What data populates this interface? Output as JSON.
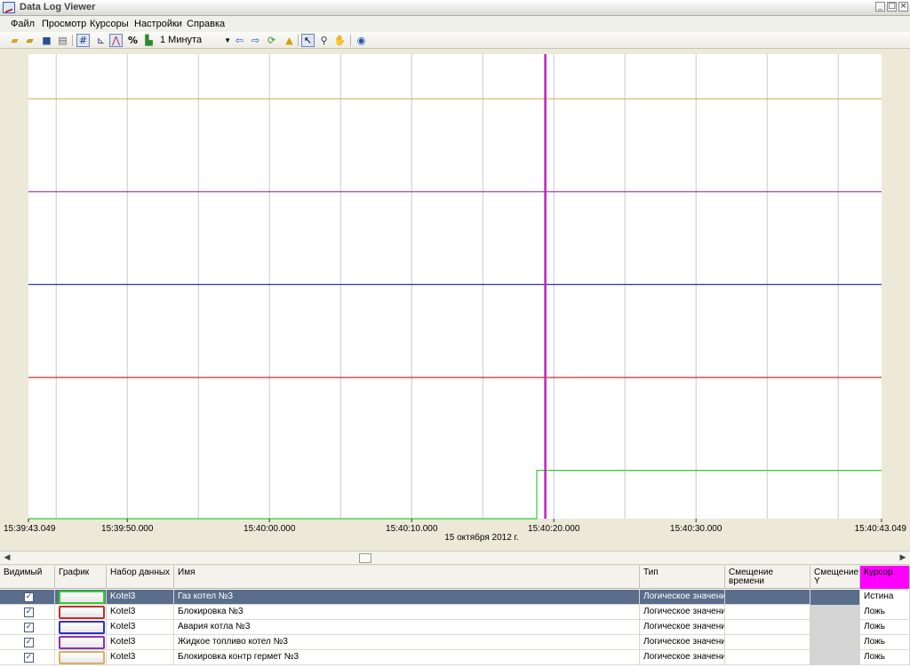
{
  "window": {
    "title": "Data Log Viewer"
  },
  "menu": [
    "Файл",
    "Просмотр",
    "Курсоры",
    "Настройки",
    "Справка"
  ],
  "toolbar": {
    "interval": "1 Минута",
    "percent_icon": "%"
  },
  "chart_data": {
    "type": "line",
    "x_ticks": [
      "15:39:43.049",
      "15:39:50.000",
      "15:40:00.000",
      "15:40:10.000",
      "15:40:20.000",
      "15:40:30.000",
      "15:40:43.049"
    ],
    "date_label": "15 октября 2012 г.",
    "x_range": [
      "15:39:43.049",
      "15:40:43.049"
    ],
    "cursor_time": "15:40:19.4",
    "grid": true,
    "series": [
      {
        "color": "#33cc33",
        "points": [
          [
            "15:39:43.049",
            0
          ],
          [
            "15:40:18.8",
            0
          ],
          [
            "15:40:18.8",
            1
          ],
          [
            "15:40:43.049",
            1
          ]
        ]
      },
      {
        "color": "#c03030",
        "points": [
          [
            "15:39:43.049",
            1
          ],
          [
            "15:40:43.049",
            1
          ]
        ]
      },
      {
        "color": "#3030c0",
        "points": [
          [
            "15:39:43.049",
            1
          ],
          [
            "15:40:43.049",
            1
          ]
        ]
      },
      {
        "color": "#9030b0",
        "points": [
          [
            "15:39:43.049",
            1
          ],
          [
            "15:40:43.049",
            1
          ]
        ]
      },
      {
        "color": "#d8b060",
        "points": [
          [
            "15:39:43.049",
            1
          ],
          [
            "15:40:43.049",
            1
          ]
        ]
      }
    ]
  },
  "table": {
    "headers": {
      "visible": "Видимый",
      "graph": "График",
      "dataset": "Набор данных",
      "name": "Имя",
      "type": "Тип",
      "time_offset": "Смещение времени",
      "y_offset": "Смещение Y",
      "cursor": "Курсор"
    },
    "rows": [
      {
        "checked": "✓",
        "color": "#33cc33",
        "dataset": "Kotel3",
        "name": "Газ котел №3",
        "type": "Логическое значение",
        "cursor": "Истина"
      },
      {
        "checked": "✓",
        "color": "#c03030",
        "dataset": "Kotel3",
        "name": "Блокировка №3",
        "type": "Логическое значение",
        "cursor": "Ложь"
      },
      {
        "checked": "✓",
        "color": "#3030c0",
        "dataset": "Kotel3",
        "name": "Авария котла №3",
        "type": "Логическое значение",
        "cursor": "Ложь"
      },
      {
        "checked": "✓",
        "color": "#9030b0",
        "dataset": "Kotel3",
        "name": "Жидкое топливо котел №3",
        "type": "Логическое значение",
        "cursor": "Ложь"
      },
      {
        "checked": "✓",
        "color": "#d8b060",
        "dataset": "Kotel3",
        "name": "Блокировка контр гермет №3",
        "type": "Логическое значение",
        "cursor": "Ложь"
      }
    ]
  }
}
